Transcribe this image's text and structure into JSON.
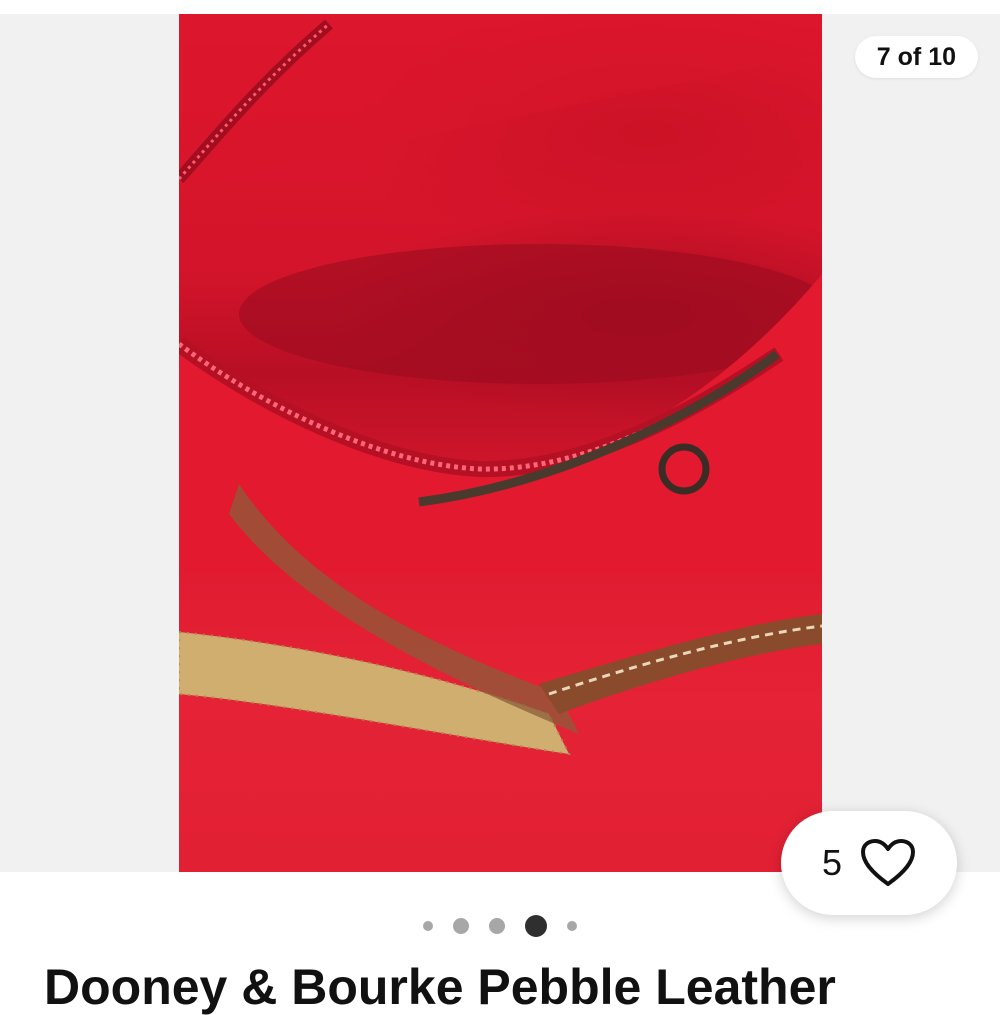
{
  "gallery": {
    "image_alt": "Red interior lining of bag with zipper pocket and tan strap",
    "counter": "7 of 10",
    "dots_total": 5,
    "dots_active_index": 3
  },
  "like": {
    "count": "5",
    "icon": "heart-outline-icon"
  },
  "listing": {
    "title": "Dooney & Bourke Pebble Leather"
  },
  "colors": {
    "gallery_background": "#f1f1f1",
    "lining_red": "#e0172e",
    "dot_active": "#2f2f2f",
    "dot_inactive": "#a7a7a7"
  }
}
